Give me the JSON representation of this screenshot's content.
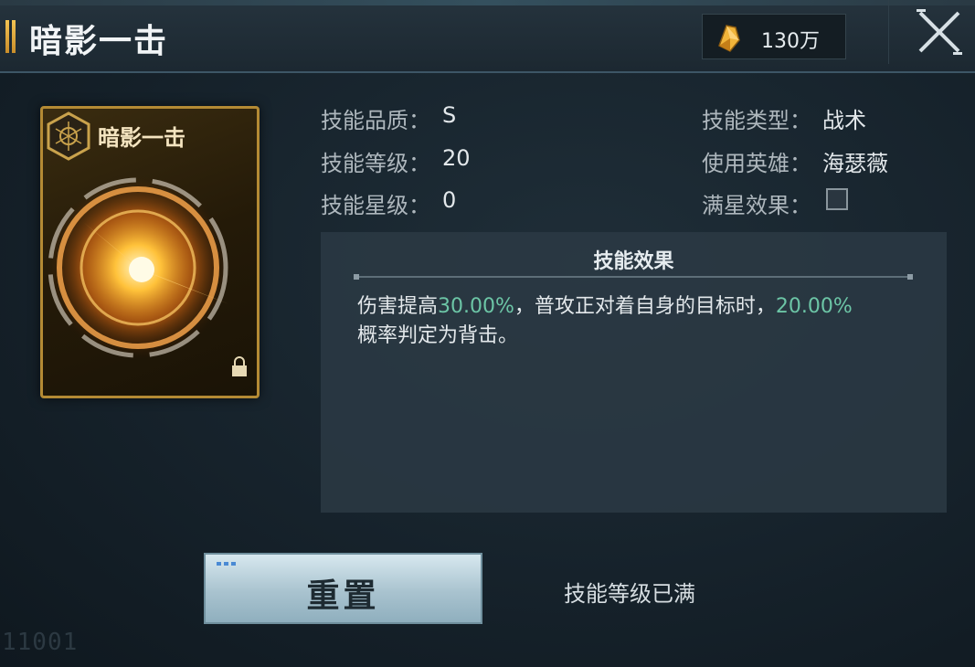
{
  "header": {
    "title": "暗影一击",
    "currency_icon": "gold-crystal-icon",
    "currency_amount": "130万",
    "close_icon": "close-icon"
  },
  "card": {
    "name": "暗影一击",
    "emblem_icon": "hexagon-emblem-icon",
    "art_icon": "golden-slash-burst-icon",
    "lock_icon": "lock-icon"
  },
  "info": {
    "quality_label": "技能品质：",
    "quality_value": "S",
    "level_label": "技能等级：",
    "level_value": "20",
    "star_label": "技能星级：",
    "star_value": "0",
    "type_label": "技能类型：",
    "type_value": "战术",
    "hero_label": "使用英雄：",
    "hero_value": "海瑟薇",
    "maxstar_label": "满星效果："
  },
  "effect": {
    "title": "技能效果",
    "text_1": "伤害提高",
    "value_1": "30.00%",
    "text_2": "，普攻正对着自身的目标时，",
    "value_2": "20.00%",
    "text_3": "概率判定为背击。"
  },
  "actions": {
    "reset_label": "重置",
    "status_text": "技能等级已满"
  },
  "watermark": "11001",
  "colors": {
    "highlight": "#6cc5a6",
    "gold": "#b48a34",
    "panel": "#2c3a44"
  }
}
